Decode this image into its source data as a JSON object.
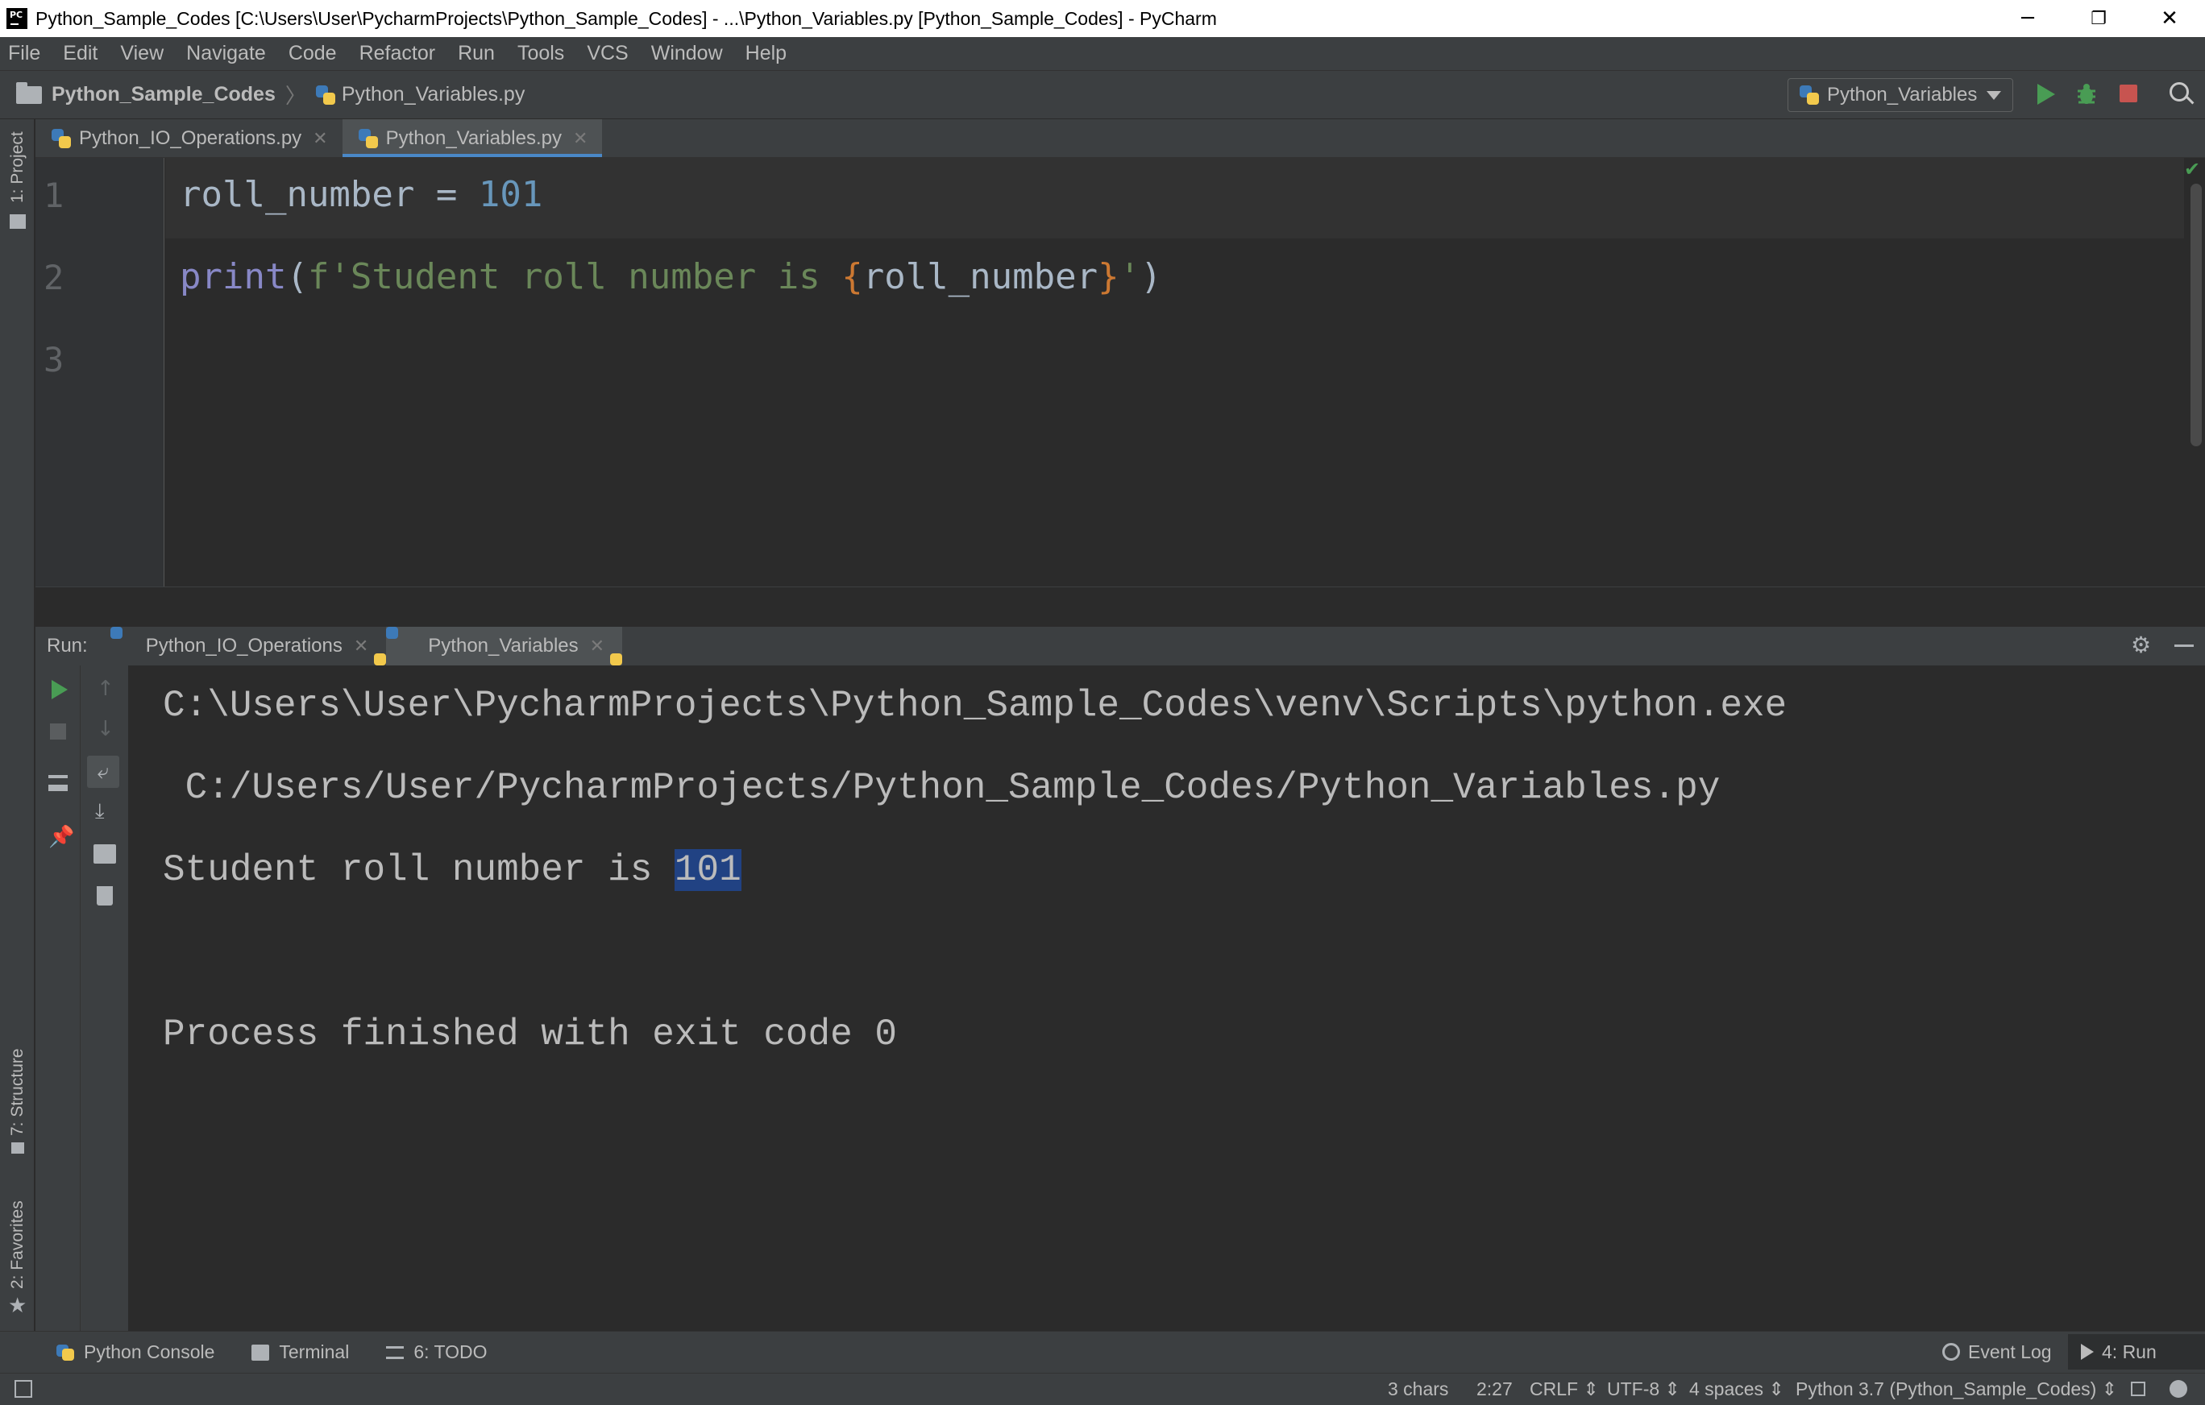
{
  "window": {
    "title": "Python_Sample_Codes [C:\\Users\\User\\PycharmProjects\\Python_Sample_Codes] - ...\\Python_Variables.py [Python_Sample_Codes] - PyCharm",
    "minimize": "─",
    "restore": "❐",
    "close": "✕"
  },
  "menu": [
    "File",
    "Edit",
    "View",
    "Navigate",
    "Code",
    "Refactor",
    "Run",
    "Tools",
    "VCS",
    "Window",
    "Help"
  ],
  "breadcrumb": {
    "project": "Python_Sample_Codes",
    "separator": "〉",
    "file": "Python_Variables.py"
  },
  "run_config": {
    "name": "Python_Variables"
  },
  "left_stripe": {
    "project": "1: Project",
    "structure": "7: Structure",
    "favorites": "2: Favorites"
  },
  "editor_tabs": [
    {
      "label": "Python_IO_Operations.py",
      "active": false
    },
    {
      "label": "Python_Variables.py",
      "active": true
    }
  ],
  "tab_close": "✕",
  "editor": {
    "line_numbers": [
      "1",
      "2",
      "3"
    ],
    "line1": {
      "var": "roll_number",
      "op": " = ",
      "num": "101"
    },
    "line2": {
      "fn": "print",
      "open": "(",
      "str_start": "f'Student roll number is ",
      "brace_open": "{",
      "expr": "roll_number",
      "brace_close": "}",
      "str_end": "'",
      "close": ")"
    }
  },
  "run_panel": {
    "title": "Run:",
    "tabs": [
      {
        "label": "Python_IO_Operations",
        "active": false
      },
      {
        "label": "Python_Variables",
        "active": true
      }
    ]
  },
  "console": {
    "line1": "C:\\Users\\User\\PycharmProjects\\Python_Sample_Codes\\venv\\Scripts\\python.exe",
    "line2": " C:/Users/User/PycharmProjects/Python_Sample_Codes/Python_Variables.py",
    "line3_prefix": "Student roll number is ",
    "line3_selected": "101",
    "line4": "Process finished with exit code 0"
  },
  "bottom_tabs": {
    "python_console": "Python Console",
    "terminal": "Terminal",
    "todo": "6: TODO",
    "event_log": "Event Log",
    "run": "4: Run"
  },
  "status": {
    "chars": "3 chars",
    "position": "2:27",
    "line_sep": "CRLF ⇕",
    "encoding": "UTF-8 ⇕",
    "indent": "4 spaces ⇕",
    "interpreter": "Python 3.7 (Python_Sample_Codes) ⇕"
  }
}
